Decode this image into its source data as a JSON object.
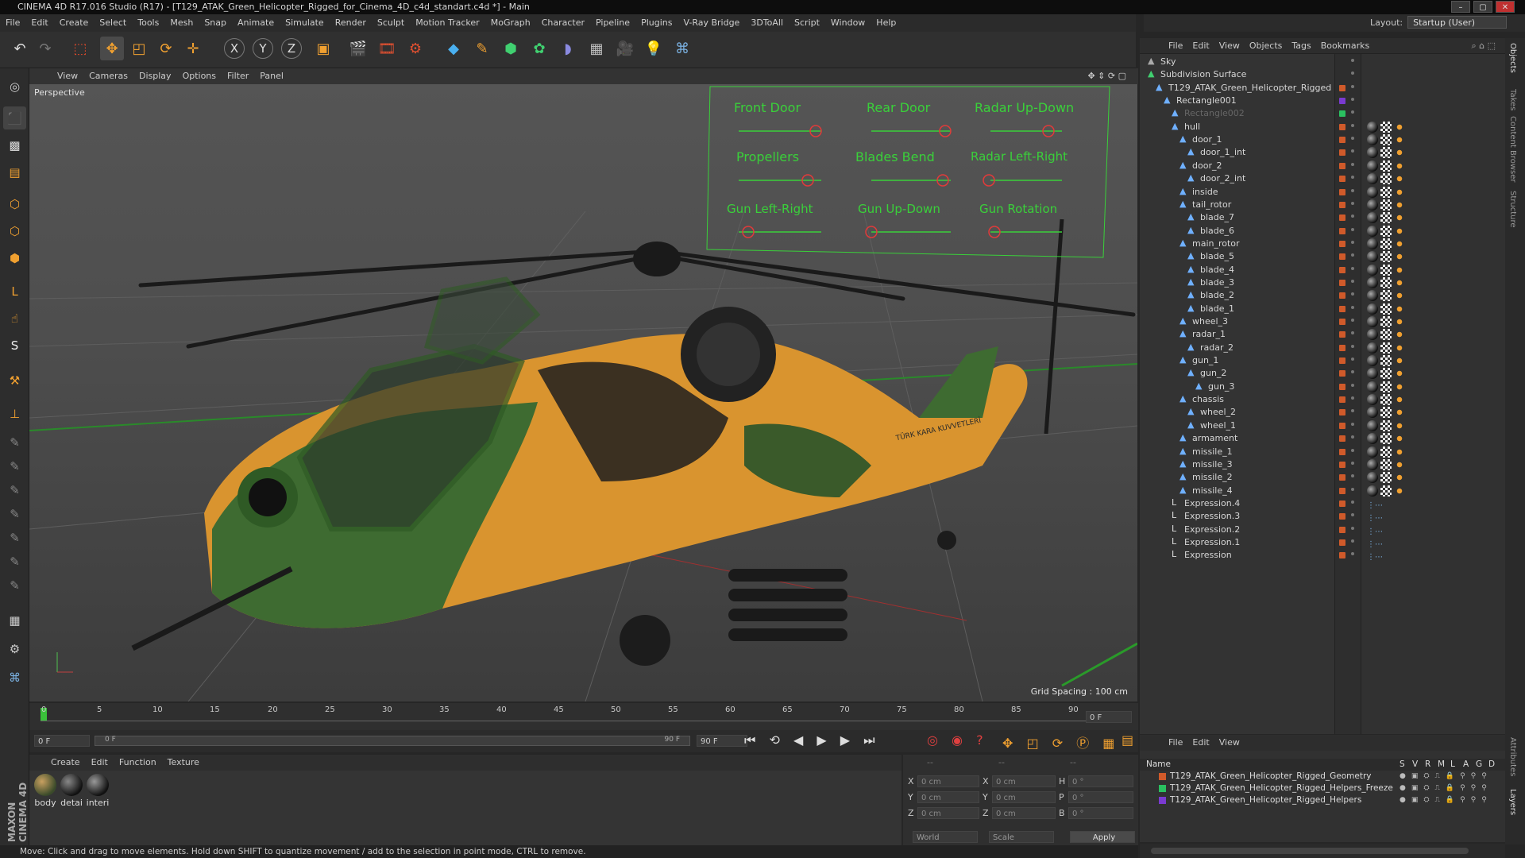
{
  "window": {
    "title": "CINEMA 4D R17.016 Studio (R17) - [T129_ATAK_Green_Helicopter_Rigged_for_Cinema_4D_c4d_standart.c4d *] - Main",
    "min": "–",
    "max": "▢",
    "close": "✕"
  },
  "menu": [
    "File",
    "Edit",
    "Create",
    "Select",
    "Tools",
    "Mesh",
    "Snap",
    "Animate",
    "Simulate",
    "Render",
    "Sculpt",
    "Motion Tracker",
    "MoGraph",
    "Character",
    "Pipeline",
    "Plugins",
    "V-Ray Bridge",
    "3DToAll",
    "Script",
    "Window",
    "Help"
  ],
  "layout": {
    "label": "Layout:",
    "value": "Startup (User)"
  },
  "viewport_menu": [
    "View",
    "Cameras",
    "Display",
    "Options",
    "Filter",
    "Panel"
  ],
  "viewport": {
    "label": "Perspective",
    "grid_spacing": "Grid Spacing : 100 cm",
    "controls": [
      "Front Door",
      "Rear Door",
      "Radar Up-Down",
      "Propellers",
      "Blades Bend",
      "Radar Left-Right",
      "Gun Left-Right",
      "Gun Up-Down",
      "Gun Rotation"
    ],
    "hull_text": "TÜRK KARA KUVVETLERİ"
  },
  "timeline": {
    "ticks": [
      "0",
      "5",
      "10",
      "15",
      "20",
      "25",
      "30",
      "35",
      "40",
      "45",
      "50",
      "55",
      "60",
      "65",
      "70",
      "75",
      "80",
      "85",
      "90"
    ],
    "current": "0 F",
    "start": "0 F",
    "range_start": "0 F",
    "range_end": "90 F",
    "end": "90 F"
  },
  "materials": {
    "menu": [
      "Create",
      "Edit",
      "Function",
      "Texture"
    ],
    "items": [
      "body",
      "detai",
      "interi"
    ]
  },
  "coords": {
    "x_label": "X",
    "y_label": "Y",
    "z_label": "Z",
    "h_label": "H",
    "p_label": "P",
    "b_label": "B",
    "pos": [
      "0 cm",
      "0 cm",
      "0 cm"
    ],
    "size": [
      "0 cm",
      "0 cm",
      "0 cm"
    ],
    "rot": [
      "0 °",
      "0 °",
      "0 °"
    ],
    "mode1": "World",
    "mode2": "Scale",
    "apply": "Apply",
    "hdr1": "--",
    "hdr2": "--",
    "hdr3": "--"
  },
  "objects": {
    "menu": [
      "File",
      "Edit",
      "View",
      "Objects",
      "Tags",
      "Bookmarks"
    ],
    "tree": [
      {
        "name": "Sky",
        "depth": 0
      },
      {
        "name": "Subdivision Surface",
        "depth": 0
      },
      {
        "name": "T129_ATAK_Green_Helicopter_Rigged",
        "depth": 1
      },
      {
        "name": "Rectangle001",
        "depth": 2
      },
      {
        "name": "Rectangle002",
        "depth": 3
      },
      {
        "name": "hull",
        "depth": 3
      },
      {
        "name": "door_1",
        "depth": 4
      },
      {
        "name": "door_1_int",
        "depth": 5
      },
      {
        "name": "door_2",
        "depth": 4
      },
      {
        "name": "door_2_int",
        "depth": 5
      },
      {
        "name": "inside",
        "depth": 4
      },
      {
        "name": "tail_rotor",
        "depth": 4
      },
      {
        "name": "blade_7",
        "depth": 5
      },
      {
        "name": "blade_6",
        "depth": 5
      },
      {
        "name": "main_rotor",
        "depth": 4
      },
      {
        "name": "blade_5",
        "depth": 5
      },
      {
        "name": "blade_4",
        "depth": 5
      },
      {
        "name": "blade_3",
        "depth": 5
      },
      {
        "name": "blade_2",
        "depth": 5
      },
      {
        "name": "blade_1",
        "depth": 5
      },
      {
        "name": "wheel_3",
        "depth": 4
      },
      {
        "name": "radar_1",
        "depth": 4
      },
      {
        "name": "radar_2",
        "depth": 5
      },
      {
        "name": "gun_1",
        "depth": 4
      },
      {
        "name": "gun_2",
        "depth": 5
      },
      {
        "name": "gun_3",
        "depth": 6
      },
      {
        "name": "chassis",
        "depth": 4
      },
      {
        "name": "wheel_2",
        "depth": 5
      },
      {
        "name": "wheel_1",
        "depth": 5
      },
      {
        "name": "armament",
        "depth": 4
      },
      {
        "name": "missile_1",
        "depth": 4
      },
      {
        "name": "missile_3",
        "depth": 4
      },
      {
        "name": "missile_2",
        "depth": 4
      },
      {
        "name": "missile_4",
        "depth": 4
      },
      {
        "name": "Expression.4",
        "depth": 3
      },
      {
        "name": "Expression.3",
        "depth": 3
      },
      {
        "name": "Expression.2",
        "depth": 3
      },
      {
        "name": "Expression.1",
        "depth": 3
      },
      {
        "name": "Expression",
        "depth": 3
      }
    ]
  },
  "layers": {
    "menu": [
      "File",
      "Edit",
      "View"
    ],
    "header": {
      "name": "Name",
      "cols": [
        "S",
        "V",
        "R",
        "M",
        "L",
        "A",
        "G",
        "D"
      ]
    },
    "rows": [
      {
        "name": "T129_ATAK_Green_Helicopter_Rigged_Geometry",
        "color": "#d05a2a"
      },
      {
        "name": "T129_ATAK_Green_Helicopter_Rigged_Helpers_Freeze",
        "color": "#2ac060"
      },
      {
        "name": "T129_ATAK_Green_Helicopter_Rigged_Helpers",
        "color": "#7a3ad0"
      }
    ]
  },
  "right_tabs": [
    "Objects",
    "Takes",
    "Content Browser",
    "Structure",
    "Attributes",
    "Layers"
  ],
  "status": "Move: Click and drag to move elements. Hold down SHIFT to quantize movement / add to the selection in point mode, CTRL to remove.",
  "brand": "MAXON CINEMA 4D",
  "toolbar_icons": [
    "undo-icon",
    "redo-icon",
    "live-select-icon",
    "move-icon",
    "scale-icon",
    "rotate-icon",
    "recent-tool-icon",
    "x-axis-icon",
    "y-axis-icon",
    "z-axis-icon",
    "coordinate-system-icon",
    "render-view-icon",
    "render-picture-icon",
    "render-settings-icon",
    "cube-icon",
    "pen-icon",
    "subdivision-icon",
    "cloner-icon",
    "deformer-icon",
    "floor-icon",
    "camera-icon",
    "light-icon",
    "python-icon"
  ],
  "toolbar_glyphs": {
    "x": "X",
    "y": "Y",
    "z": "Z"
  }
}
